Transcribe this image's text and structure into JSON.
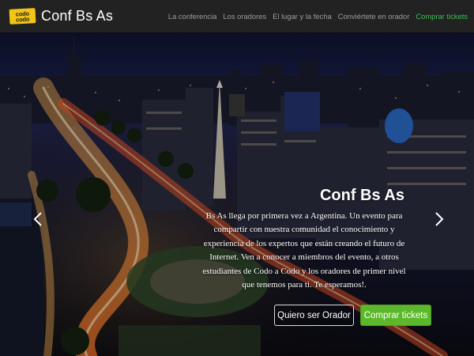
{
  "navbar": {
    "logo_line1": "codo",
    "logo_line2": "codo",
    "brand_title": "Conf Bs As",
    "links": [
      {
        "label": "La conferencia"
      },
      {
        "label": "Los oradores"
      },
      {
        "label": "El lugar y la fecha"
      },
      {
        "label": "Conviértete en orador"
      },
      {
        "label": "Comprar tickets"
      }
    ],
    "accent_color": "#3bbf55"
  },
  "hero": {
    "title": "Conf Bs As",
    "description": "Bs As llega por primera vez a Argentina. Un evento para compartir con nuestra comunidad el conocimiento y experiencia de los expertos que están creando el futuro de Internet. Ven a conocer a miembros del evento, a otros estudiantes de Codo a Codo y los oradores de primer nivel que tenemos para ti. Te esperamos!.",
    "buttons": {
      "speaker": "Quiero ser Orador",
      "tickets": "Comprar tickets"
    },
    "button_color": "#5cb82a",
    "background": "night-city-avenue-obelisk-image"
  },
  "carousel": {
    "prev_icon": "chevron-left-icon",
    "next_icon": "chevron-right-icon"
  }
}
